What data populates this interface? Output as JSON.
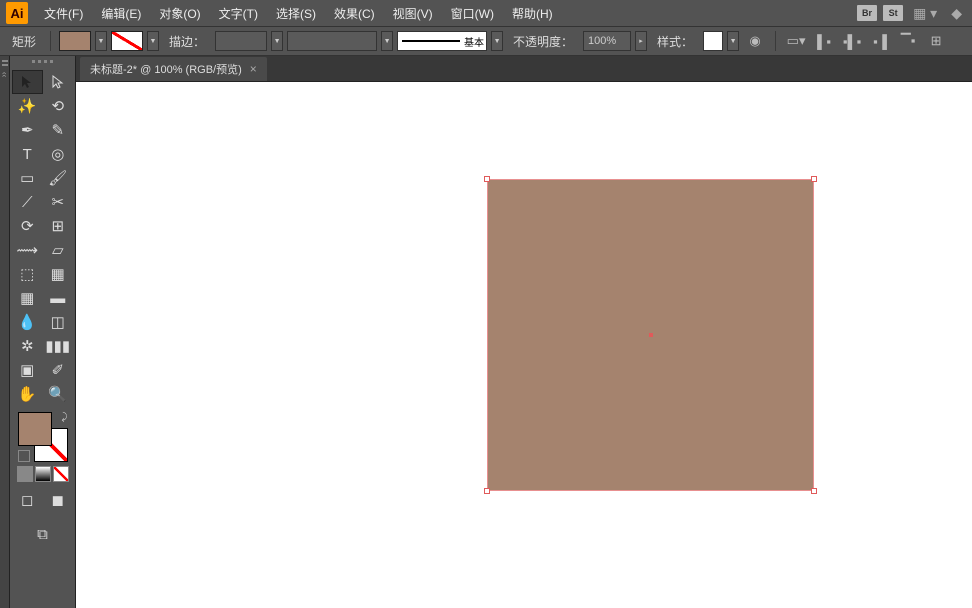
{
  "app_logo": "Ai",
  "menu": {
    "file": "文件(F)",
    "edit": "编辑(E)",
    "object": "对象(O)",
    "type": "文字(T)",
    "select": "选择(S)",
    "effect": "效果(C)",
    "view": "视图(V)",
    "window": "窗口(W)",
    "help": "帮助(H)"
  },
  "menu_extras": {
    "br": "Br",
    "st": "St"
  },
  "control": {
    "shape": "矩形",
    "stroke_label": "描边：",
    "stroke_weight": "",
    "stroke_style_label": "基本",
    "opacity_label": "不透明度：",
    "opacity_value": "100%",
    "style_label": "样式："
  },
  "doc": {
    "tab_title": "未标题-2* @ 100% (RGB/预览)",
    "tab_close": "×"
  },
  "colors": {
    "fill": "#a5836e",
    "stroke": "none"
  },
  "tools": {
    "selection": "selection",
    "direct_selection": "direct-selection",
    "magic_wand": "magic-wand",
    "lasso": "lasso",
    "pen": "pen",
    "curvature": "curvature",
    "type": "type",
    "touch_type": "touch-type",
    "rectangle": "rectangle",
    "paintbrush": "paintbrush",
    "shaper": "shaper",
    "scissors": "scissors",
    "rotate": "rotate",
    "reflect": "reflect",
    "width": "width",
    "free_transform": "free-transform",
    "shape_builder": "shape-builder",
    "perspective": "perspective",
    "mesh": "mesh",
    "gradient": "gradient",
    "eyedropper": "eyedropper",
    "blend": "blend",
    "symbol_sprayer": "symbol-sprayer",
    "column_graph": "column-graph",
    "artboard": "artboard",
    "slice": "slice",
    "hand": "hand",
    "zoom": "zoom"
  }
}
